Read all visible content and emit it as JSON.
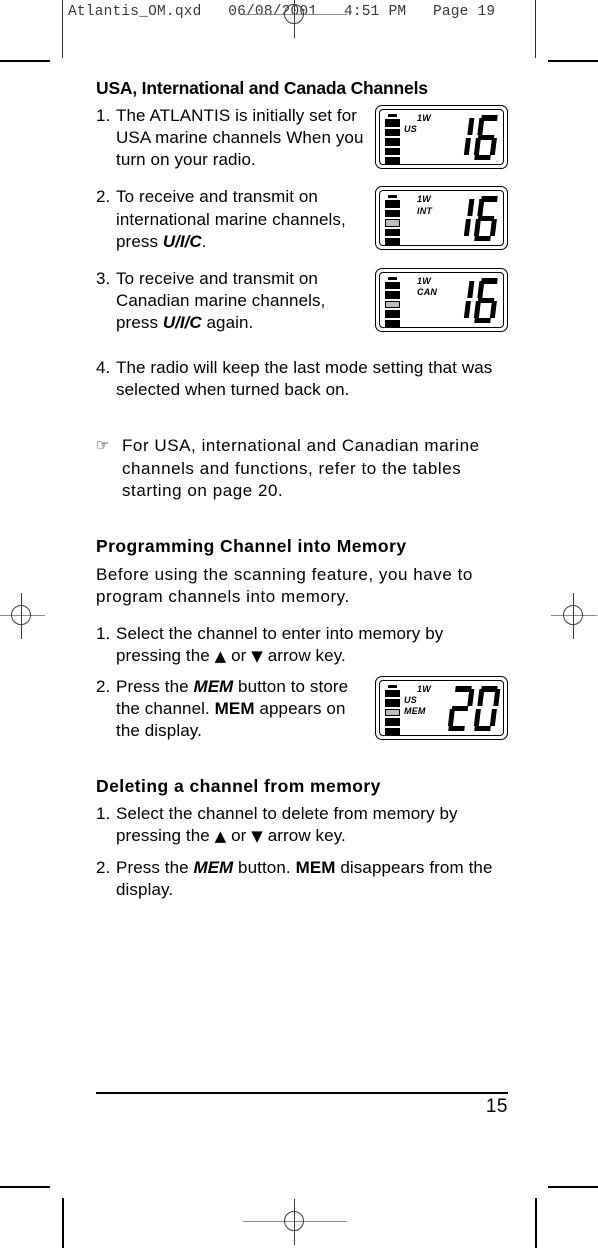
{
  "print_marks": {
    "file_header": "Atlantis_OM.qxd   06/08/2001   4:51 PM   Page 19",
    "registration_icon": "registration-crosshair"
  },
  "page": {
    "number": "15",
    "sections": [
      {
        "heading": "USA, International and Canada Channels"
      },
      {
        "heading": "Programming Channel into Memory",
        "intro": "Before using the scanning feature, you have to program channels into memory."
      },
      {
        "heading": "Deleting a channel from memory"
      }
    ]
  },
  "section1": {
    "heading": "USA, International and Canada Channels",
    "items": [
      {
        "num": "1.",
        "text_a": "The ATLANTIS is initially set for USA marine channels When you turn on your radio.",
        "emphasis": "",
        "text_b": ""
      },
      {
        "num": "2.",
        "text_a": "To receive and transmit on international marine channels, press ",
        "emphasis": "U/I/C",
        "text_b": "."
      },
      {
        "num": "3.",
        "text_a": "To receive and transmit on Canadian marine channels, press ",
        "emphasis": "U/I/C",
        "text_b": " again."
      },
      {
        "num": "4.",
        "text_a": "The radio will keep the last mode setting that was selected when turned back on.",
        "emphasis": "",
        "text_b": ""
      }
    ],
    "note": {
      "icon": "pointing-hand-icon",
      "glyph": "☞",
      "text": "For USA, international and Canadian marine channels and functions, refer to the tables starting on page 20."
    }
  },
  "section2": {
    "heading": "Programming Channel into Memory",
    "intro": "Before using the scanning feature, you have to program channels into memory.",
    "items": [
      {
        "num": "1.",
        "text_a": "Select the channel to enter into memory by pressing the ",
        "up_arrow": "▲",
        "mid": " or ",
        "down_arrow": "▼",
        "text_b": " arrow key."
      },
      {
        "num": "2.",
        "text_a": "Press the ",
        "emphasis": "MEM",
        "text_b": " button to store the channel. ",
        "emphasis2": "MEM",
        "text_c": " appears on the display."
      }
    ]
  },
  "section3": {
    "heading": "Deleting a channel from memory",
    "items": [
      {
        "num": "1.",
        "text_a": "Select the channel to delete from memory by pressing the ",
        "up_arrow": "▲",
        "mid": " or ",
        "down_arrow": "▼",
        "text_b": " arrow key."
      },
      {
        "num": "2.",
        "text_a": "Press the ",
        "emphasis": "MEM",
        "text_b": " button. ",
        "emphasis2": "MEM",
        "text_c": " disappears from the display."
      }
    ]
  },
  "displays": [
    {
      "name": "lcd-display-usa",
      "power": "1W",
      "mode1": "US",
      "mode2": "",
      "mode1_indent": false,
      "channel": "16",
      "battery_segments": 5,
      "battery_dim_index": -1
    },
    {
      "name": "lcd-display-int",
      "power": "1W",
      "mode1": "INT",
      "mode2": "",
      "mode1_indent": true,
      "channel": "16",
      "battery_segments": 5,
      "battery_dim_index": 2
    },
    {
      "name": "lcd-display-can",
      "power": "1W",
      "mode1": "CAN",
      "mode2": "",
      "mode1_indent": true,
      "channel": "16",
      "battery_segments": 5,
      "battery_dim_index": 2
    },
    {
      "name": "lcd-display-mem",
      "power": "1W",
      "mode1": "US",
      "mode2": "MEM",
      "mode1_indent": false,
      "channel": "20",
      "battery_segments": 5,
      "battery_dim_index": 2
    }
  ],
  "colors": {
    "ink": "#000000",
    "paper": "#ffffff",
    "mark_gray": "#8a8a8a",
    "header_gray": "#3a3a3a"
  }
}
